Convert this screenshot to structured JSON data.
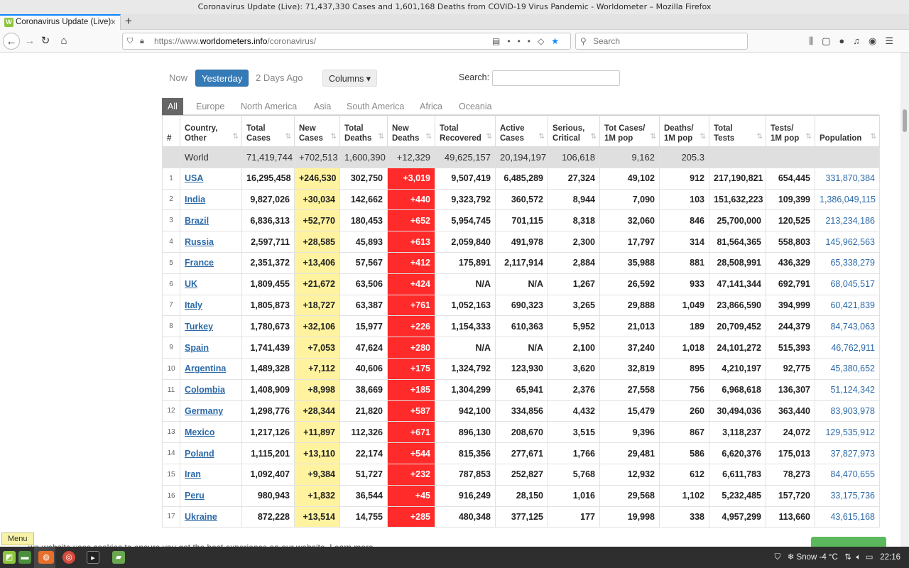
{
  "window": {
    "title": "Coronavirus Update (Live): 71,437,330 Cases and 1,601,168 Deaths from COVID-19 Virus Pandemic - Worldometer – Mozilla Firefox"
  },
  "tab": {
    "label": "Coronavirus Update (Live):",
    "favicon": "W",
    "close": "×",
    "new_tab": "+"
  },
  "navbar": {
    "url_scheme": "https://www.",
    "url_host": "worldometers.info",
    "url_path": "/coronavirus/",
    "search_placeholder": "Search"
  },
  "controls": {
    "day_tabs": [
      "Now",
      "Yesterday",
      "2 Days Ago"
    ],
    "columns_label": "Columns ▾",
    "search_label": "Search:"
  },
  "region_tabs": [
    "All",
    "Europe",
    "North America",
    "Asia",
    "South America",
    "Africa",
    "Oceania"
  ],
  "table": {
    "headers": [
      "#",
      "Country,\nOther",
      "Total\nCases",
      "New\nCases",
      "Total\nDeaths",
      "New\nDeaths",
      "Total\nRecovered",
      "Active\nCases",
      "Serious,\nCritical",
      "Tot Cases/\n1M pop",
      "Deaths/\n1M pop",
      "Total\nTests",
      "Tests/\n1M pop",
      "Population"
    ],
    "world": [
      "",
      "World",
      "71,419,744",
      "+702,513",
      "1,600,390",
      "+12,329",
      "49,625,157",
      "20,194,197",
      "106,618",
      "9,162",
      "205.3",
      "",
      "",
      ""
    ],
    "rows": [
      [
        "1",
        "USA",
        "16,295,458",
        "+246,530",
        "302,750",
        "+3,019",
        "9,507,419",
        "6,485,289",
        "27,324",
        "49,102",
        "912",
        "217,190,821",
        "654,445",
        "331,870,384"
      ],
      [
        "2",
        "India",
        "9,827,026",
        "+30,034",
        "142,662",
        "+440",
        "9,323,792",
        "360,572",
        "8,944",
        "7,090",
        "103",
        "151,632,223",
        "109,399",
        "1,386,049,115"
      ],
      [
        "3",
        "Brazil",
        "6,836,313",
        "+52,770",
        "180,453",
        "+652",
        "5,954,745",
        "701,115",
        "8,318",
        "32,060",
        "846",
        "25,700,000",
        "120,525",
        "213,234,186"
      ],
      [
        "4",
        "Russia",
        "2,597,711",
        "+28,585",
        "45,893",
        "+613",
        "2,059,840",
        "491,978",
        "2,300",
        "17,797",
        "314",
        "81,564,365",
        "558,803",
        "145,962,563"
      ],
      [
        "5",
        "France",
        "2,351,372",
        "+13,406",
        "57,567",
        "+412",
        "175,891",
        "2,117,914",
        "2,884",
        "35,988",
        "881",
        "28,508,991",
        "436,329",
        "65,338,279"
      ],
      [
        "6",
        "UK",
        "1,809,455",
        "+21,672",
        "63,506",
        "+424",
        "N/A",
        "N/A",
        "1,267",
        "26,592",
        "933",
        "47,141,344",
        "692,791",
        "68,045,517"
      ],
      [
        "7",
        "Italy",
        "1,805,873",
        "+18,727",
        "63,387",
        "+761",
        "1,052,163",
        "690,323",
        "3,265",
        "29,888",
        "1,049",
        "23,866,590",
        "394,999",
        "60,421,839"
      ],
      [
        "8",
        "Turkey",
        "1,780,673",
        "+32,106",
        "15,977",
        "+226",
        "1,154,333",
        "610,363",
        "5,952",
        "21,013",
        "189",
        "20,709,452",
        "244,379",
        "84,743,063"
      ],
      [
        "9",
        "Spain",
        "1,741,439",
        "+7,053",
        "47,624",
        "+280",
        "N/A",
        "N/A",
        "2,100",
        "37,240",
        "1,018",
        "24,101,272",
        "515,393",
        "46,762,911"
      ],
      [
        "10",
        "Argentina",
        "1,489,328",
        "+7,112",
        "40,606",
        "+175",
        "1,324,792",
        "123,930",
        "3,620",
        "32,819",
        "895",
        "4,210,197",
        "92,775",
        "45,380,652"
      ],
      [
        "11",
        "Colombia",
        "1,408,909",
        "+8,998",
        "38,669",
        "+185",
        "1,304,299",
        "65,941",
        "2,376",
        "27,558",
        "756",
        "6,968,618",
        "136,307",
        "51,124,342"
      ],
      [
        "12",
        "Germany",
        "1,298,776",
        "+28,344",
        "21,820",
        "+587",
        "942,100",
        "334,856",
        "4,432",
        "15,479",
        "260",
        "30,494,036",
        "363,440",
        "83,903,978"
      ],
      [
        "13",
        "Mexico",
        "1,217,126",
        "+11,897",
        "112,326",
        "+671",
        "896,130",
        "208,670",
        "3,515",
        "9,396",
        "867",
        "3,118,237",
        "24,072",
        "129,535,912"
      ],
      [
        "14",
        "Poland",
        "1,115,201",
        "+13,110",
        "22,174",
        "+544",
        "815,356",
        "277,671",
        "1,766",
        "29,481",
        "586",
        "6,620,376",
        "175,013",
        "37,827,973"
      ],
      [
        "15",
        "Iran",
        "1,092,407",
        "+9,384",
        "51,727",
        "+232",
        "787,853",
        "252,827",
        "5,768",
        "12,932",
        "612",
        "6,611,783",
        "78,273",
        "84,470,655"
      ],
      [
        "16",
        "Peru",
        "980,943",
        "+1,832",
        "36,544",
        "+45",
        "916,249",
        "28,150",
        "1,016",
        "29,568",
        "1,102",
        "5,232,485",
        "157,720",
        "33,175,736"
      ],
      [
        "17",
        "Ukraine",
        "872,228",
        "+13,514",
        "14,755",
        "+285",
        "480,348",
        "377,125",
        "177",
        "19,998",
        "338",
        "4,957,299",
        "113,660",
        "43,615,168"
      ]
    ]
  },
  "taskbar": {
    "menu_tooltip": "Menu",
    "weather": "Snow -4 °C",
    "time": "22:16"
  },
  "colors": {
    "accent": "#337ab7",
    "new_cases_bg": "#fff3a0",
    "new_deaths_bg": "#ff2a2a",
    "link": "#2c6aa8"
  }
}
